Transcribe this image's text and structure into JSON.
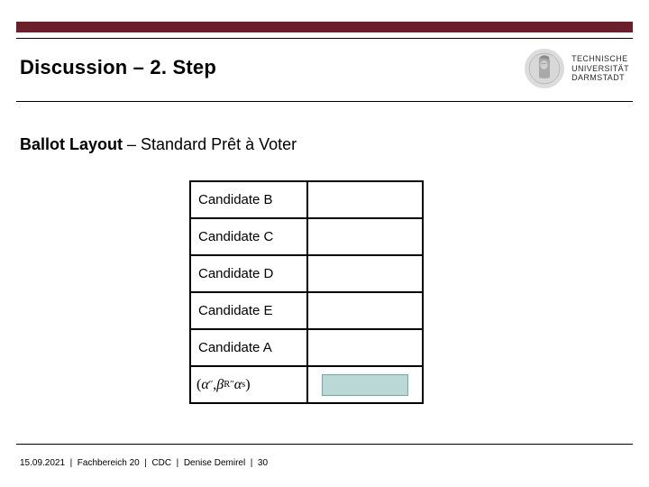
{
  "header": {
    "title": "Discussion – 2. Step",
    "logo": {
      "line1": "TECHNISCHE",
      "line2": "UNIVERSITÄT",
      "line3": "DARMSTADT"
    }
  },
  "subtitle": {
    "bold": "Ballot Layout",
    "rest": " – Standard Prêt à Voter"
  },
  "ballot": {
    "rows": [
      {
        "label": "Candidate B"
      },
      {
        "label": "Candidate C"
      },
      {
        "label": "Candidate D"
      },
      {
        "label": "Candidate E"
      },
      {
        "label": "Candidate A"
      }
    ],
    "math": "(α′′, β_R′′ α^s)"
  },
  "footer": {
    "date": "15.09.2021",
    "dept": "Fachbereich 20",
    "group": "CDC",
    "author": "Denise Demirel",
    "page": "30"
  },
  "colors": {
    "accent_bar": "#6b1f2a",
    "swatch_fill": "#b9d8d6",
    "swatch_border": "#6fa8a4"
  }
}
